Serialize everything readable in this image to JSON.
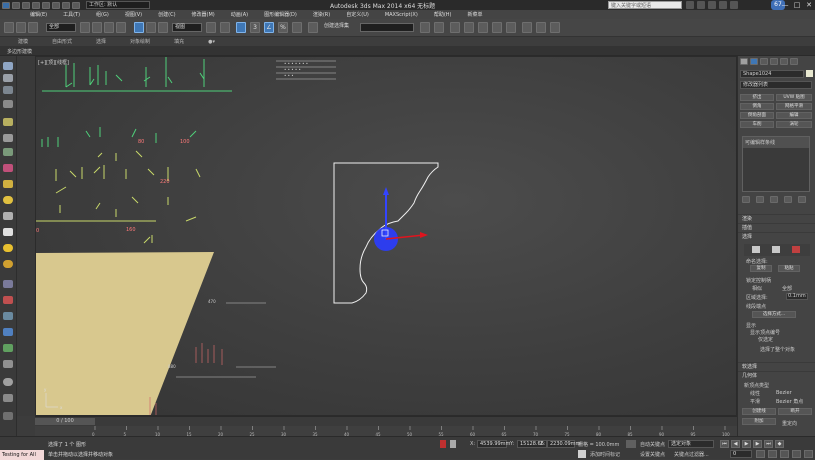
{
  "window": {
    "app_title": "Autodesk 3ds Max  2014 x64    无标题",
    "workspace": "工作区: 默认",
    "search_placeholder": "键入关键字或短语",
    "window_controls": [
      "—",
      "□",
      "✕"
    ],
    "user_badge": "67"
  },
  "menu": {
    "items": [
      "编辑(E)",
      "工具(T)",
      "组(G)",
      "视图(V)",
      "创建(C)",
      "修改器(M)",
      "动画(A)",
      "图形编辑器(D)",
      "渲染(R)",
      "自定义(U)",
      "MAXScript(X)",
      "帮助(H)",
      "新菜单"
    ]
  },
  "toolbar": {
    "selection_filter": "全部",
    "view_dropdown": "视图",
    "named_selection": "创建选择集",
    "snap_label": "3",
    "angle_snap": "∠",
    "percent_snap": "%"
  },
  "ribbon": {
    "tabs": [
      "建模",
      "自由形式",
      "选择",
      "对象绘制",
      "填充"
    ],
    "panel_label": "多边形建模"
  },
  "viewport": {
    "label": "[+][顶][线框]",
    "side_numbers": [
      "90",
      "0",
      "80",
      "100",
      "120",
      "40",
      "160",
      "470",
      "880"
    ],
    "scene_labels": [
      "220",
      "160"
    ],
    "gizmo_axis_x": "x",
    "gizmo_axis_y": "y"
  },
  "command_panel": {
    "object_name": "Shape1024",
    "modifier_list": "修改器列表",
    "buttons": [
      "挤出",
      "UVW 贴图",
      "倒角",
      "网格平滑",
      "倒角剖面",
      "编辑",
      "车削",
      "涡轮"
    ],
    "stack_item": "可编辑样条线",
    "rollouts": [
      "渲染",
      "插值",
      "选择",
      "软选择",
      "几何体"
    ],
    "selection_sub": [
      "命名选择:",
      "复制",
      "粘贴"
    ],
    "lock_handles": [
      "锁定控制柄",
      "相似",
      "全部"
    ],
    "area_selection": "区域选择:",
    "area_value": "0.1mm",
    "segment_end": "线段端点",
    "select_by": "选择方式...",
    "display": "显示",
    "show_vertex_numbers": "显示顶点编号",
    "selected_only": "仅选定",
    "status_selected": "选择了整个对象",
    "new_vertex_type": "新顶点类型",
    "vertex_types": [
      "线性",
      "Bezier",
      "平滑",
      "Bezier 角点"
    ],
    "create_line": "创建线",
    "break": "断开",
    "attach": "附加",
    "reorient": "重定向"
  },
  "timeline": {
    "slider": "0 / 100",
    "ticks": [
      "0",
      "5",
      "10",
      "15",
      "20",
      "25",
      "30",
      "35",
      "40",
      "45",
      "50",
      "55",
      "60",
      "65",
      "70",
      "75",
      "80",
      "85",
      "90",
      "95",
      "100"
    ]
  },
  "status": {
    "script_prompt": "Testing for All",
    "message1": "选择了 1 个 图形",
    "message2": "单击并拖动以选择并移动对象",
    "x_label": "X:",
    "x_value": "4539.99mm",
    "y_label": "Y:",
    "y_value": "15128.66",
    "z_label": "Z:",
    "z_value": "2230.09mm",
    "grid_label": "栅格 = 100.0mm",
    "auto_key": "自动关键点",
    "key_mode": "选定对象",
    "set_key": "设置关键点",
    "key_filters": "关键点过滤器...",
    "add_time_tag": "添加时间标记",
    "frame": "0"
  },
  "colors": {
    "accent_blue": "#3f77b5",
    "gizmo_blue": "#2a3cff",
    "gizmo_red": "#e0141e",
    "shape_white": "#f0f0f0",
    "tan_fill": "#d8c88e",
    "script_bg": "#f2d8d8"
  }
}
